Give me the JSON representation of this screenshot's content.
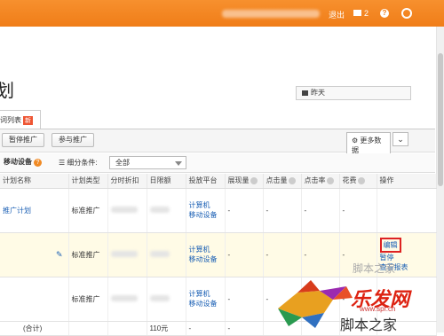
{
  "topbar": {
    "logout": "退出",
    "mail_count": "2",
    "help": "?"
  },
  "page": {
    "title": "划",
    "date_button": "昨天"
  },
  "tab": {
    "label": "词列表",
    "badge": "新"
  },
  "toolbar": {
    "pause_label": "暂停推广",
    "join_label": "参与推广",
    "more_data_line1": "更多数",
    "more_data_line2": "据",
    "move_device": "移动设备",
    "segment_label": "细分条件:",
    "segment_value": "全部"
  },
  "table": {
    "headers": [
      "计划名称",
      "计划类型",
      "分时折扣",
      "日限额",
      "投放平台",
      "展现量",
      "点击量",
      "点击率",
      "花费",
      "操作"
    ],
    "rows": [
      {
        "name": "推广计划",
        "type": "标准推广",
        "platform1": "计算机",
        "platform2": "移动设备",
        "impr": "-",
        "clicks": "-",
        "ctr": "-",
        "cost": "-"
      },
      {
        "name": "",
        "type": "标准推广",
        "platform1": "计算机",
        "platform2": "移动设备",
        "impr": "-",
        "clicks": "-",
        "ctr": "-",
        "cost": "-",
        "op_edit": "编辑",
        "op_pause": "暂停",
        "op_report": "查看报表"
      },
      {
        "name": "",
        "type": "标准推广",
        "platform1": "计算机",
        "platform2": "移动设备",
        "impr": "-",
        "clicks": "-",
        "ctr": "-",
        "cost": "-"
      }
    ],
    "total_label": "(合计)",
    "total_budget": "110元",
    "total_dash": "-"
  },
  "watermark": {
    "brand": "乐发网",
    "url": "www.spf.cn",
    "site": "脚本之家",
    "top": "脚本之家"
  },
  "colors": {
    "topbar": "#f07d18",
    "link": "#1a5fb4",
    "highlight_border": "#dd2222"
  }
}
